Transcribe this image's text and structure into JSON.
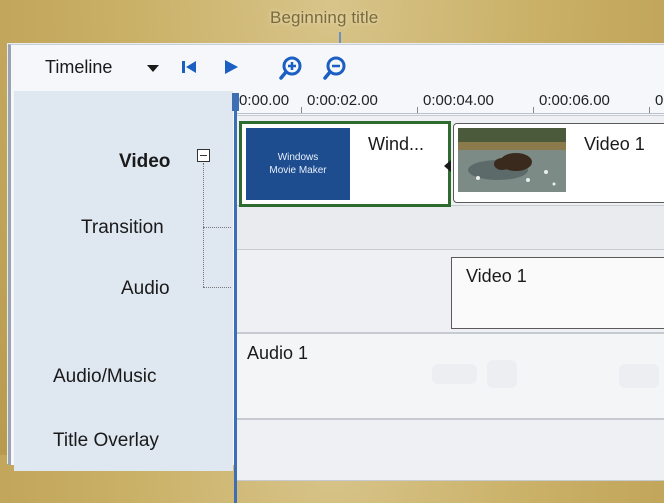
{
  "callout": {
    "text": "Beginning title"
  },
  "toolbar": {
    "timeline_label": "Timeline"
  },
  "ruler": {
    "ticks": [
      "0:00.00",
      "0:00:02.00",
      "0:00:04.00",
      "0:00:06.00",
      "0"
    ]
  },
  "tracks": {
    "video": "Video",
    "transition": "Transition",
    "audio": "Audio",
    "audio_music": "Audio/Music",
    "title_overlay": "Title Overlay"
  },
  "clips": {
    "title_clip": "Wind...",
    "title_thumb_line1": "Windows",
    "title_thumb_line2": "Movie Maker",
    "video_clip": "Video 1",
    "audio_clip": "Video 1",
    "music_clip": "Audio 1"
  },
  "colors": {
    "accent": "#3e6fb5",
    "title_thumb_bg": "#1d4d8f",
    "selected_clip_border": "#2f6b2f"
  }
}
